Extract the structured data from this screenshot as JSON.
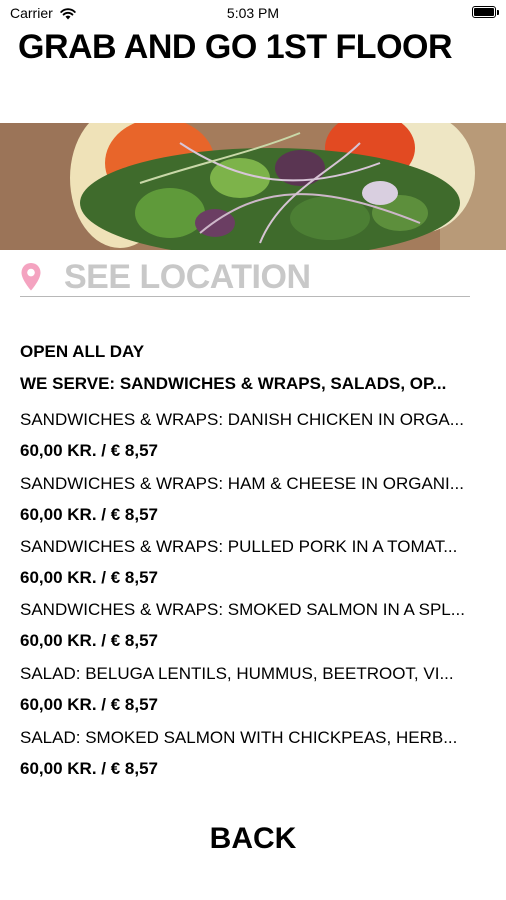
{
  "status_bar": {
    "carrier": "Carrier",
    "time": "5:03 PM"
  },
  "page": {
    "title": "GRAB AND GO 1ST FLOOR"
  },
  "location": {
    "label": "SEE LOCATION",
    "accent": "#f4a3c0"
  },
  "hours": "OPEN ALL DAY",
  "serves": "WE SERVE: SANDWICHES & WRAPS, SALADS, OP...",
  "menu": [
    {
      "name": "SANDWICHES & WRAPS: DANISH CHICKEN IN ORGA...",
      "price": "60,00 KR. / € 8,57"
    },
    {
      "name": "SANDWICHES & WRAPS: HAM & CHEESE IN ORGANI...",
      "price": "60,00 KR. / € 8,57"
    },
    {
      "name": "SANDWICHES & WRAPS: PULLED PORK IN A TOMAT...",
      "price": "60,00 KR. / € 8,57"
    },
    {
      "name": "SANDWICHES & WRAPS: SMOKED SALMON IN A SPL...",
      "price": "60,00 KR. / € 8,57"
    },
    {
      "name": "SALAD: BELUGA LENTILS, HUMMUS, BEETROOT, VI...",
      "price": "60,00 KR. / € 8,57"
    },
    {
      "name": "SALAD: SMOKED SALMON WITH CHICKPEAS, HERB...",
      "price": "60,00 KR. / € 8,57"
    }
  ],
  "back_label": "BACK"
}
